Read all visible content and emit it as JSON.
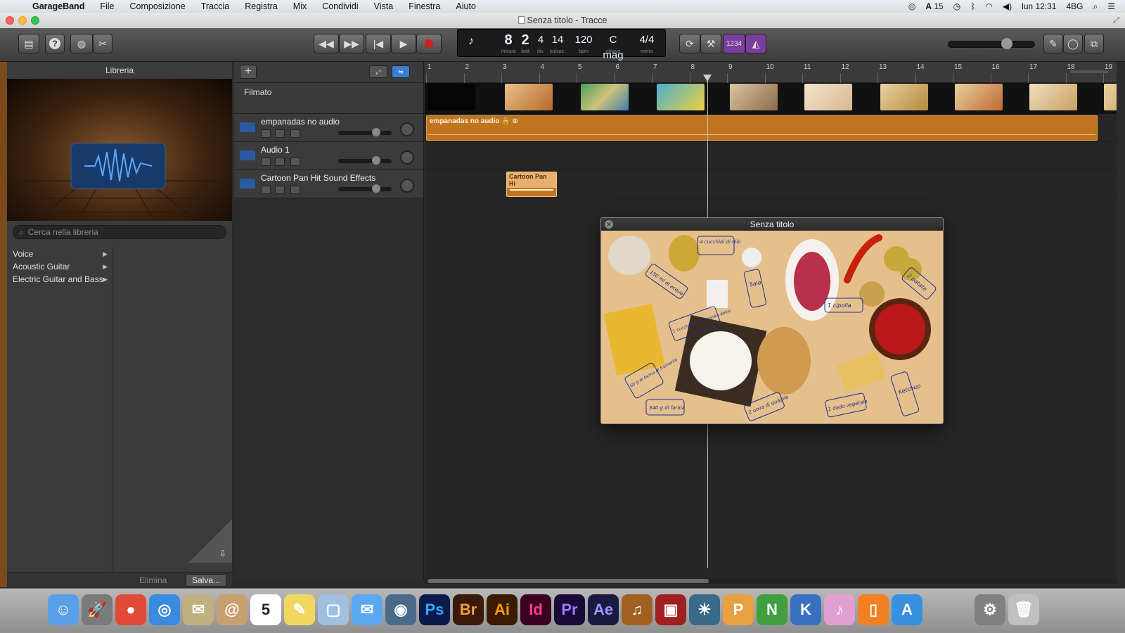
{
  "menubar": {
    "app": "GarageBand",
    "items": [
      "File",
      "Composizione",
      "Traccia",
      "Registra",
      "Mix",
      "Condividi",
      "Vista",
      "Finestra",
      "Aiuto"
    ],
    "right": [
      "15",
      "lun 12:31",
      "4BG"
    ]
  },
  "window": {
    "title": "Senza titolo - Tracce"
  },
  "lcd": {
    "measure": "8",
    "beat": "2",
    "div": "4",
    "tick": "14",
    "tempo": "120",
    "key": "C mag",
    "signature": "4/4",
    "labels": [
      "misura",
      "batt.",
      "div.",
      "pulsaz.",
      "bpm",
      "chiave",
      "metro"
    ]
  },
  "toolbar": {
    "count_in": "1234"
  },
  "library": {
    "title": "Libreria",
    "search_placeholder": "Cerca nella libreria",
    "items": [
      "Voice",
      "Acoustic Guitar",
      "Electric Guitar and Bass"
    ],
    "delete_label": "Elimina",
    "save_label": "Salva..."
  },
  "tracks": {
    "movie_label": "Filmato",
    "list": [
      {
        "name": "empanadas no audio",
        "region": "empanadas no audio",
        "color": "#c07420"
      },
      {
        "name": "Audio 1",
        "region": "",
        "color": "#c07420"
      },
      {
        "name": "Cartoon Pan Hit Sound Effects",
        "region": "Cartoon Pan Hi",
        "color": "#c07420"
      }
    ]
  },
  "ruler": {
    "bars": [
      "1",
      "2",
      "3",
      "4",
      "5",
      "6",
      "7",
      "8",
      "9",
      "10",
      "11",
      "12",
      "13",
      "14",
      "15",
      "16",
      "17",
      "18",
      "19"
    ]
  },
  "video_window": {
    "title": "Senza titolo",
    "labels": [
      "4 cucchiai di olio",
      "150 ml di acqua",
      "Sale",
      "1 cipolla",
      "2 patate",
      "1 cucchiaino di paprika dolce",
      "Ketchup",
      "60 g di farina di frumento",
      "340 g di farina",
      "2 uova di quaglia",
      "1 dado vegetale"
    ]
  },
  "dock": {
    "apps": [
      "Finder",
      "Launchpad",
      "Chrome",
      "Safari",
      "Mail",
      "Contacts",
      "Calendar",
      "Notes",
      "Preview",
      "Messages",
      "FaceTime",
      "Ps",
      "Br",
      "Ai",
      "Id",
      "Pr",
      "Ae",
      "GarageBand",
      "Photo Booth",
      "iPhoto",
      "Pages",
      "Numbers",
      "Keynote",
      "iTunes",
      "iBooks",
      "App Store",
      "System Preferences",
      "Trash"
    ],
    "calendar_day": "5"
  }
}
